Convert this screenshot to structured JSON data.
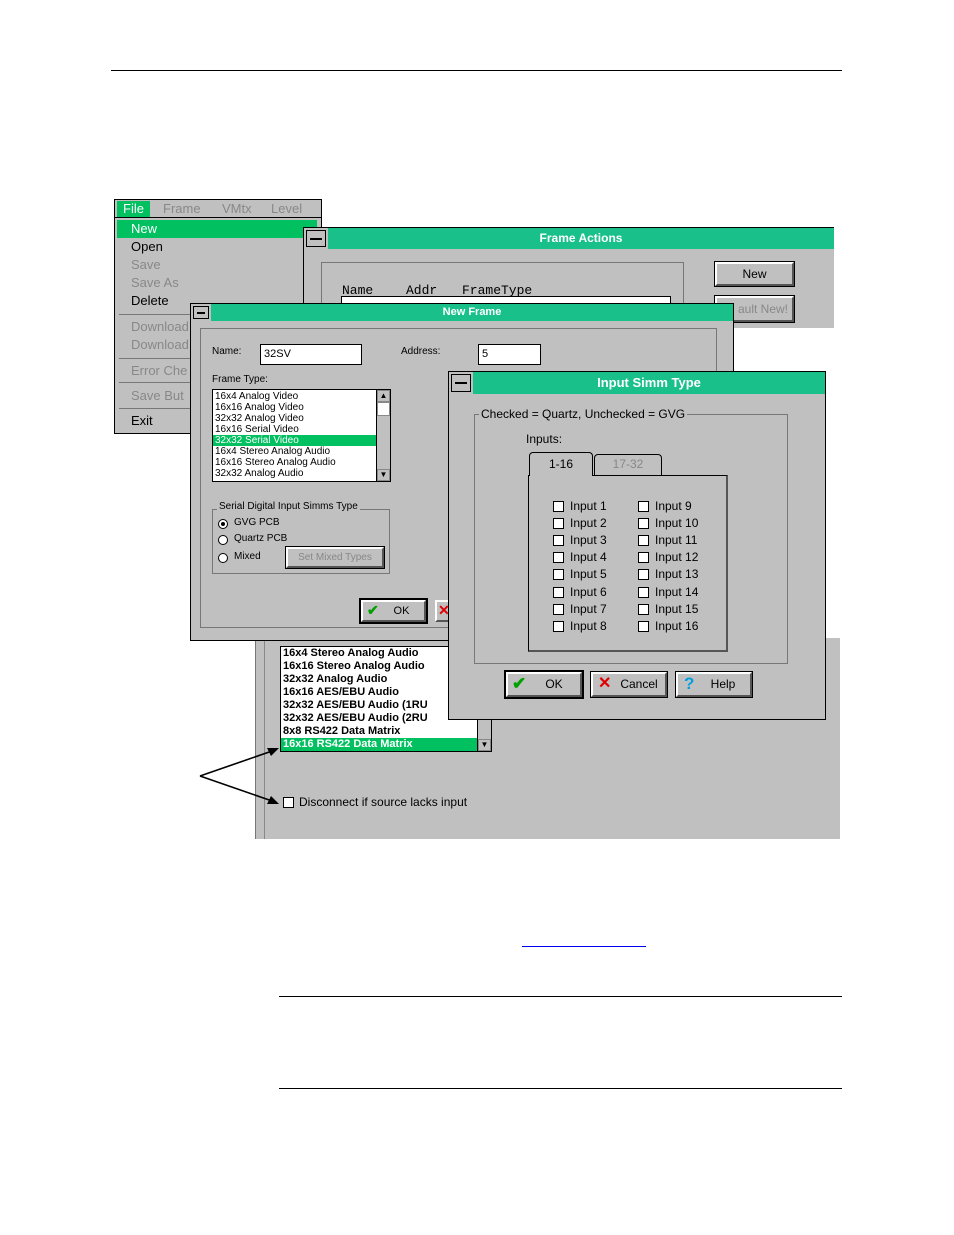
{
  "menubar": {
    "items": [
      "File",
      "Frame",
      "VMtx",
      "Level"
    ]
  },
  "file_menu": {
    "items": [
      {
        "label": "New",
        "state": "highlighted"
      },
      {
        "label": "Open",
        "state": "enabled"
      },
      {
        "label": "Save",
        "state": "disabled"
      },
      {
        "label": "Save As",
        "state": "disabled"
      },
      {
        "label": "Delete",
        "state": "enabled"
      },
      {
        "label": "Download",
        "state": "disabled"
      },
      {
        "label": "Download",
        "state": "disabled"
      },
      {
        "label": "Error Che",
        "state": "disabled"
      },
      {
        "label": "Save But",
        "state": "disabled"
      },
      {
        "label": "Exit",
        "state": "enabled"
      }
    ]
  },
  "frame_actions": {
    "title": "Frame Actions",
    "col_name": "Name",
    "col_addr": "Addr",
    "col_frametype": "FrameType",
    "new_button": "New",
    "default_new_button": "ault New!"
  },
  "new_frame": {
    "title": "New Frame",
    "name_label": "Name:",
    "name_value": "32SV",
    "address_label": "Address:",
    "address_value": "5",
    "frame_type_label": "Frame Type:",
    "frame_types": [
      "16x4  Analog Video",
      "16x16 Analog Video",
      "32x32 Analog Video",
      "16x16 Serial Video",
      "32x32 Serial Video",
      "16x4  Stereo Analog Audio",
      "16x16 Stereo Analog Audio",
      "32x32 Analog Audio"
    ],
    "selected_type": "32x32 Serial Video",
    "simms_group_label": "Serial Digital Input Simms Type",
    "radio_gvg": "GVG PCB",
    "radio_quartz": "Quartz PCB",
    "radio_mixed": "Mixed",
    "set_mixed_button": "Set Mixed Types",
    "ok_button": "OK"
  },
  "input_simm": {
    "title": "Input Simm Type",
    "group_label": "Checked = Quartz, Unchecked = GVG",
    "inputs_label": "Inputs:",
    "tab_active": "1-16",
    "tab_inactive": "17-32",
    "inputs_col1": [
      "Input 1",
      "Input 2",
      "Input 3",
      "Input 4",
      "Input 5",
      "Input 6",
      "Input 7",
      "Input 8"
    ],
    "inputs_col2": [
      "Input 9",
      "Input 10",
      "Input 11",
      "Input 12",
      "Input 13",
      "Input 14",
      "Input 15",
      "Input 16"
    ],
    "ok_button": "OK",
    "cancel_button": "Cancel",
    "help_button": "Help"
  },
  "bottom_panel": {
    "list_items": [
      "16x4  Stereo Analog Audio",
      "16x16 Stereo Analog Audio",
      "32x32 Analog Audio",
      "16x16 AES/EBU Audio",
      "32x32 AES/EBU Audio (1RU",
      "32x32 AES/EBU Audio (2RU",
      "8x8 RS422 Data Matrix",
      "16x16 RS422 Data Matrix"
    ],
    "selected_item": "16x16 RS422 Data Matrix",
    "disconnect_label": "Disconnect if source lacks input"
  },
  "colors": {
    "title_green": "#19c08a",
    "select_green": "#00c060",
    "dialog_gray": "#c0c0c0",
    "link_blue": "#0000ee"
  }
}
